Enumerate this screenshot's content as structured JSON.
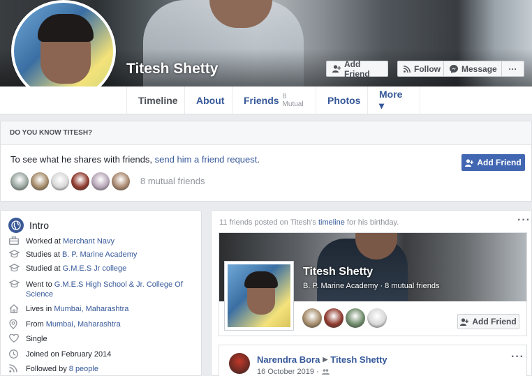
{
  "profile": {
    "name": "Titesh Shetty"
  },
  "cover_actions": {
    "add_friend": "Add Friend",
    "follow": "Follow",
    "message": "Message",
    "more": "···"
  },
  "nav": {
    "tabs": [
      {
        "label": "Timeline"
      },
      {
        "label": "About"
      },
      {
        "label": "Friends",
        "sub": "8 Mutual"
      },
      {
        "label": "Photos"
      },
      {
        "label": "More ▾"
      }
    ]
  },
  "know": {
    "heading": "DO YOU KNOW TITESH?",
    "text_prefix": "To see what he shares with friends, ",
    "link": "send him a friend request",
    "text_suffix": ".",
    "button": "Add Friend",
    "mutual_count": "8 mutual friends",
    "mutual_avatar_colors": [
      "#9aa6a0",
      "#a58b6a",
      "#d8d8d8",
      "#8f3a2e",
      "#b7a6b8",
      "#a9886f"
    ]
  },
  "intro": {
    "title": "Intro",
    "items": [
      {
        "icon": "briefcase-icon",
        "prefix": "Worked at ",
        "link": "Merchant Navy",
        "suffix": ""
      },
      {
        "icon": "graduation-cap-icon",
        "prefix": "Studies at ",
        "link": "B. P. Marine Academy",
        "suffix": ""
      },
      {
        "icon": "graduation-cap-icon",
        "prefix": "Studied at ",
        "link": "G.M.E.S Jr college",
        "suffix": ""
      },
      {
        "icon": "graduation-cap-icon",
        "prefix": "Went to ",
        "link": "G.M.E.S High School & Jr. College Of Science",
        "suffix": ""
      },
      {
        "icon": "home-icon",
        "prefix": "Lives in ",
        "link": "Mumbai, Maharashtra",
        "suffix": ""
      },
      {
        "icon": "location-pin-icon",
        "prefix": "From ",
        "link": "Mumbai, Maharashtra",
        "suffix": ""
      },
      {
        "icon": "heart-icon",
        "prefix": "Single",
        "link": "",
        "suffix": ""
      },
      {
        "icon": "clock-icon",
        "prefix": "Joined on February 2014",
        "link": "",
        "suffix": ""
      },
      {
        "icon": "rss-icon",
        "prefix": "Followed by ",
        "link": "8 people",
        "suffix": ""
      }
    ]
  },
  "birthday": {
    "prefix": "11 friends posted on Titesh's ",
    "link": "timeline",
    "suffix": " for his birthday.",
    "dots": "···"
  },
  "share_card": {
    "name": "Titesh Shetty",
    "sub": "B. P. Marine Academy · 8 mutual friends",
    "button": "Add Friend",
    "friend_colors": [
      "#a58b6a",
      "#8f3a2e",
      "#6f8a6a",
      "#d8d8d8"
    ]
  },
  "post": {
    "author": "Narendra Bora",
    "target": "Titesh Shetty",
    "date": "16 October 2019 ·",
    "dots": "···"
  }
}
